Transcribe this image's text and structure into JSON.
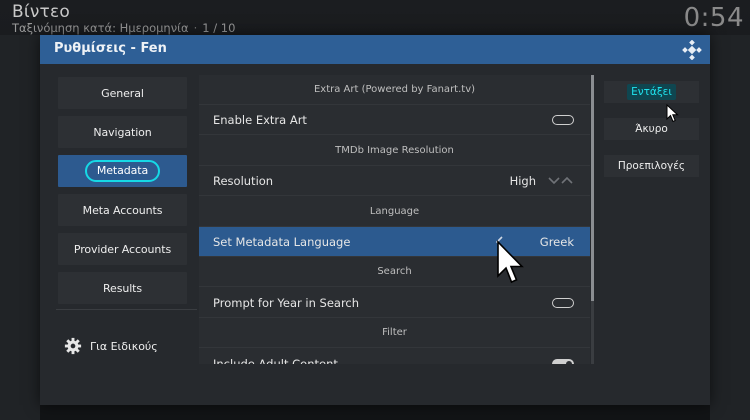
{
  "header": {
    "title": "Βίντεο",
    "sort_label": "Ταξινόμηση κατά: Ημερομηνία",
    "page_counter": "1 / 10",
    "clock": "0:54"
  },
  "dialog": {
    "title": "Ρυθμίσεις - Fen",
    "logo_icon": "kodi-logo-icon"
  },
  "menu": {
    "items": [
      {
        "label": "General"
      },
      {
        "label": "Navigation"
      },
      {
        "label": "Metadata"
      },
      {
        "label": "Meta Accounts"
      },
      {
        "label": "Provider Accounts"
      },
      {
        "label": "Results"
      }
    ],
    "active_index": 2,
    "specialist_label": "Για Ειδικούς"
  },
  "settings": {
    "rows": [
      {
        "kind": "section",
        "label": "Extra Art (Powered by Fanart.tv)"
      },
      {
        "kind": "setting",
        "name": "Enable Extra Art",
        "control": "toggle",
        "state": "off"
      },
      {
        "kind": "section",
        "label": "TMDb Image Resolution"
      },
      {
        "kind": "setting",
        "name": "Resolution",
        "value": "High",
        "control": "spinner"
      },
      {
        "kind": "section",
        "label": "Language"
      },
      {
        "kind": "setting",
        "name": "Set Metadata Language",
        "value": "Greek",
        "control": "value",
        "selected": true
      },
      {
        "kind": "section",
        "label": "Search"
      },
      {
        "kind": "setting",
        "name": "Prompt for Year in Search",
        "control": "toggle",
        "state": "off"
      },
      {
        "kind": "section",
        "label": "Filter"
      },
      {
        "kind": "setting",
        "name": "Include Adult Content",
        "control": "toggle",
        "state": "on"
      }
    ]
  },
  "buttons": {
    "ok": "Εντάξει",
    "cancel": "Άκυρο",
    "defaults": "Προεπιλογές"
  },
  "colors": {
    "titlebar": "#2e5f96",
    "selected_row": "#2c5a8f",
    "focus_accent": "#16d9e6"
  }
}
